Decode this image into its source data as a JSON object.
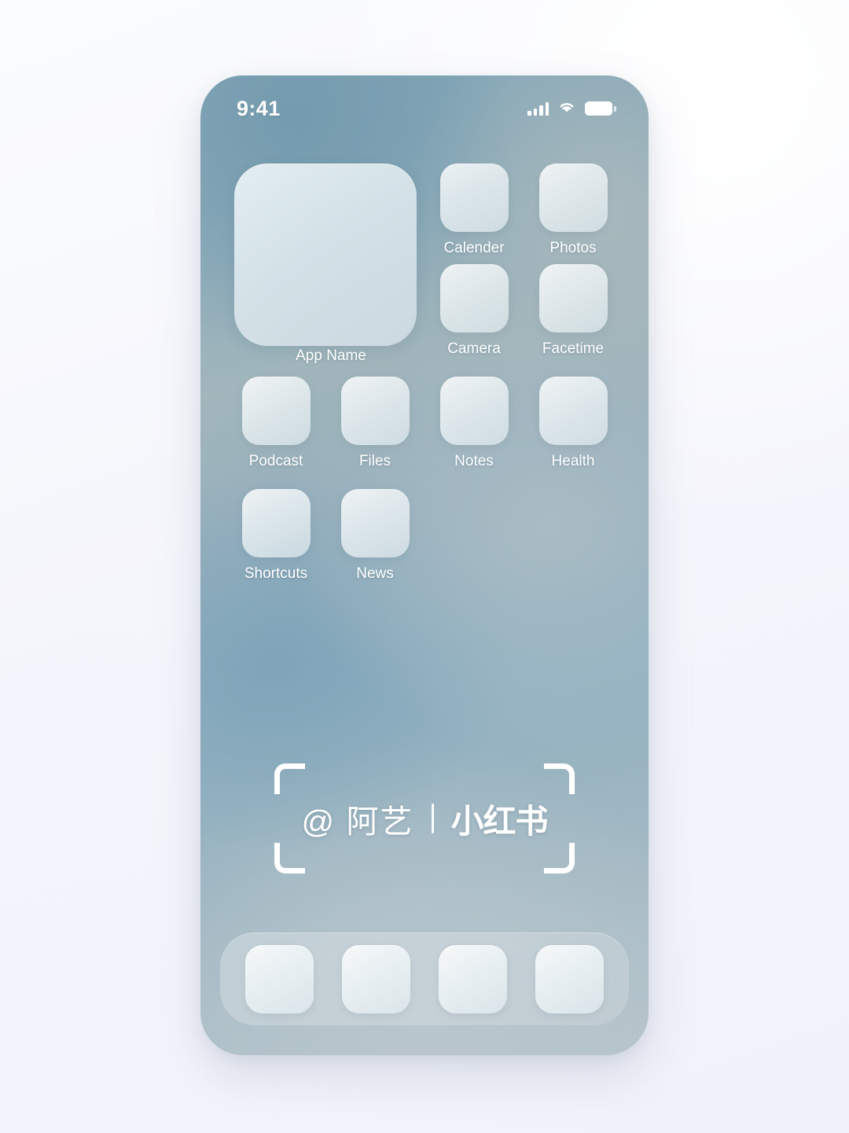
{
  "background": {
    "accent_light": "#f5f6fc",
    "accent_white": "#ffffff"
  },
  "phone": {
    "wallpaper_color": "#8fb0c2",
    "tile_color": "#dfeaef"
  },
  "status_bar": {
    "time": "9:41",
    "signal_icon": "cellular-signal-icon",
    "wifi_icon": "wifi-icon",
    "battery_icon": "battery-full-icon"
  },
  "home_screen": {
    "rows": [
      {
        "cells": [
          {
            "label": "App Name",
            "type": "widget",
            "icon": "app-widget-placeholder-icon"
          },
          {
            "label": "Calender",
            "type": "app",
            "icon": "calendar-app-icon"
          },
          {
            "label": "Photos",
            "type": "app",
            "icon": "photos-app-icon"
          }
        ]
      },
      {
        "cells": [
          {
            "label": "",
            "type": "spacer",
            "icon": ""
          },
          {
            "label": "Camera",
            "type": "app",
            "icon": "camera-app-icon"
          },
          {
            "label": "Facetime",
            "type": "app",
            "icon": "facetime-app-icon"
          }
        ]
      },
      {
        "cells": [
          {
            "label": "Podcast",
            "type": "app",
            "icon": "podcast-app-icon"
          },
          {
            "label": "Files",
            "type": "app",
            "icon": "files-app-icon"
          },
          {
            "label": "Notes",
            "type": "app",
            "icon": "notes-app-icon"
          },
          {
            "label": "Health",
            "type": "app",
            "icon": "health-app-icon"
          }
        ]
      },
      {
        "cells": [
          {
            "label": "Shortcuts",
            "type": "app",
            "icon": "shortcuts-app-icon"
          },
          {
            "label": "News",
            "type": "app",
            "icon": "news-app-icon"
          }
        ]
      }
    ]
  },
  "watermark": {
    "handle": "@ 阿艺",
    "divider": "|",
    "brand": "小红书",
    "corner_icon": "crop-corner-bracket-icon"
  },
  "dock": {
    "items": [
      {
        "icon": "dock-app-icon-1"
      },
      {
        "icon": "dock-app-icon-2"
      },
      {
        "icon": "dock-app-icon-3"
      },
      {
        "icon": "dock-app-icon-4"
      }
    ]
  }
}
